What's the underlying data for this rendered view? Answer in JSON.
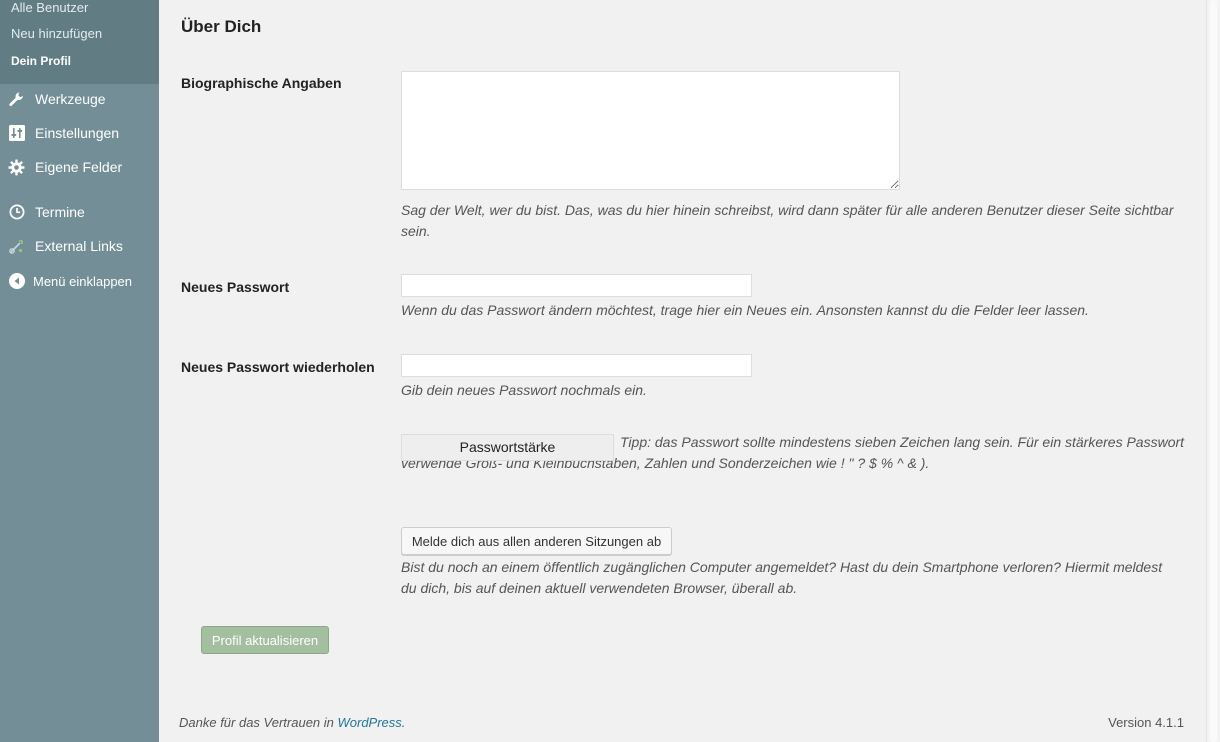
{
  "sidebar": {
    "submenu": [
      {
        "label": "Alle Benutzer"
      },
      {
        "label": "Neu hinzufügen"
      },
      {
        "label": "Dein Profil"
      }
    ],
    "menu": [
      {
        "label": "Werkzeuge",
        "icon": "wrench-icon"
      },
      {
        "label": "Einstellungen",
        "icon": "settings-sliders-icon"
      },
      {
        "label": "Eigene Felder",
        "icon": "gear-icon"
      },
      {
        "label": "Termine",
        "icon": "clock-icon"
      },
      {
        "label": "External Links",
        "icon": "links-icon"
      },
      {
        "label": "Menü einklappen",
        "icon": "collapse-arrow-icon"
      }
    ]
  },
  "section": {
    "title": "Über Dich",
    "bio": {
      "label": "Biographische Angaben",
      "value": "",
      "description": "Sag der Welt, wer du bist. Das, was du hier hinein schreibst, wird dann später für alle anderen Benutzer dieser Seite sichtbar sein."
    },
    "new_password": {
      "label": "Neues Passwort",
      "value": "",
      "description": "Wenn du das Passwort ändern möchtest, trage hier ein Neues ein. Ansonsten kannst du die Felder leer lassen."
    },
    "repeat_password": {
      "label": "Neues Passwort wiederholen",
      "value": "",
      "description": "Gib dein neues Passwort nochmals ein."
    },
    "strength": {
      "label": "Passwortstärke",
      "hint": "Tipp: das Passwort sollte mindestens sieben Zeichen lang sein. Für ein stärkeres Passwort verwende Groß- und Kleinbuchstaben, Zahlen und Sonderzeichen wie ! \" ? $ % ^ & )."
    },
    "sessions": {
      "button_label": "Melde dich aus allen anderen Sitzungen ab",
      "description": "Bist du noch an einem öffentlich zugänglichen Computer angemeldet? Hast du dein Smartphone verloren? Hiermit meldest du dich, bis auf deinen aktuell verwendeten Browser, überall ab."
    },
    "submit_label": "Profil aktualisieren"
  },
  "footer": {
    "thanks_prefix": "Danke für das Vertrauen in ",
    "thanks_link": "WordPress",
    "thanks_suffix": ".",
    "version": "Version 4.1.1"
  },
  "colors": {
    "sidebar_bg": "#738e96",
    "submenu_bg": "#627c83",
    "submit_bg": "#a3bfa0",
    "link": "#21759b"
  }
}
